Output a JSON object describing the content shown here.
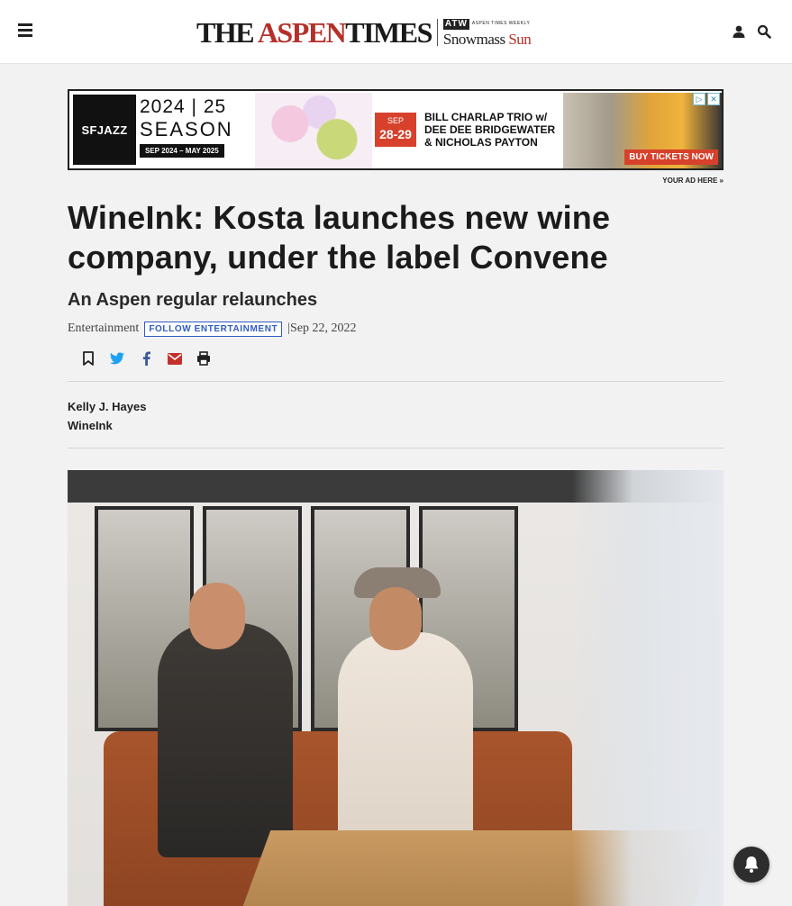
{
  "header": {
    "logo": {
      "the_aspen": "THE ",
      "aspen": "ASPEN",
      "times": "TIMES",
      "weekly_mark": "ATW",
      "weekly_text": "ASPEN TIMES WEEKLY",
      "snowmass": "Snowmass ",
      "sun": "Sun"
    },
    "icons": [
      "hamburger-menu-icon",
      "user-icon",
      "search-icon"
    ]
  },
  "ad": {
    "brand": "SFJAZZ",
    "season_year": "2024 | 25",
    "season_word": "SEASON",
    "season_dates": "SEP 2024 – MAY 2025",
    "month": "SEP",
    "days": "28-29",
    "lineup": "BILL CHARLAP TRIO w/ DEE DEE BRIDGEWATER & NICHOLAS PAYTON",
    "cta": "BUY TICKETS NOW",
    "your_ad_here": "YOUR AD HERE »"
  },
  "article": {
    "headline": "WineInk: Kosta launches new wine company, under the label Convene",
    "subhead": "An Aspen regular relaunches",
    "category": "Entertainment",
    "follow_label": "FOLLOW ENTERTAINMENT",
    "date_separator": "| ",
    "date": "Sep 22, 2022",
    "author": "Kelly J. Hayes",
    "column": "WineInk"
  },
  "share_icons": [
    "bookmark-icon",
    "twitter-icon",
    "facebook-icon",
    "email-icon",
    "print-icon"
  ],
  "colors": {
    "brand_red": "#b5302a",
    "follow_blue": "#2f5bc4",
    "share_blue": "#1da1f2",
    "facebook_blue": "#3b5998",
    "email_red": "#c4302b"
  }
}
